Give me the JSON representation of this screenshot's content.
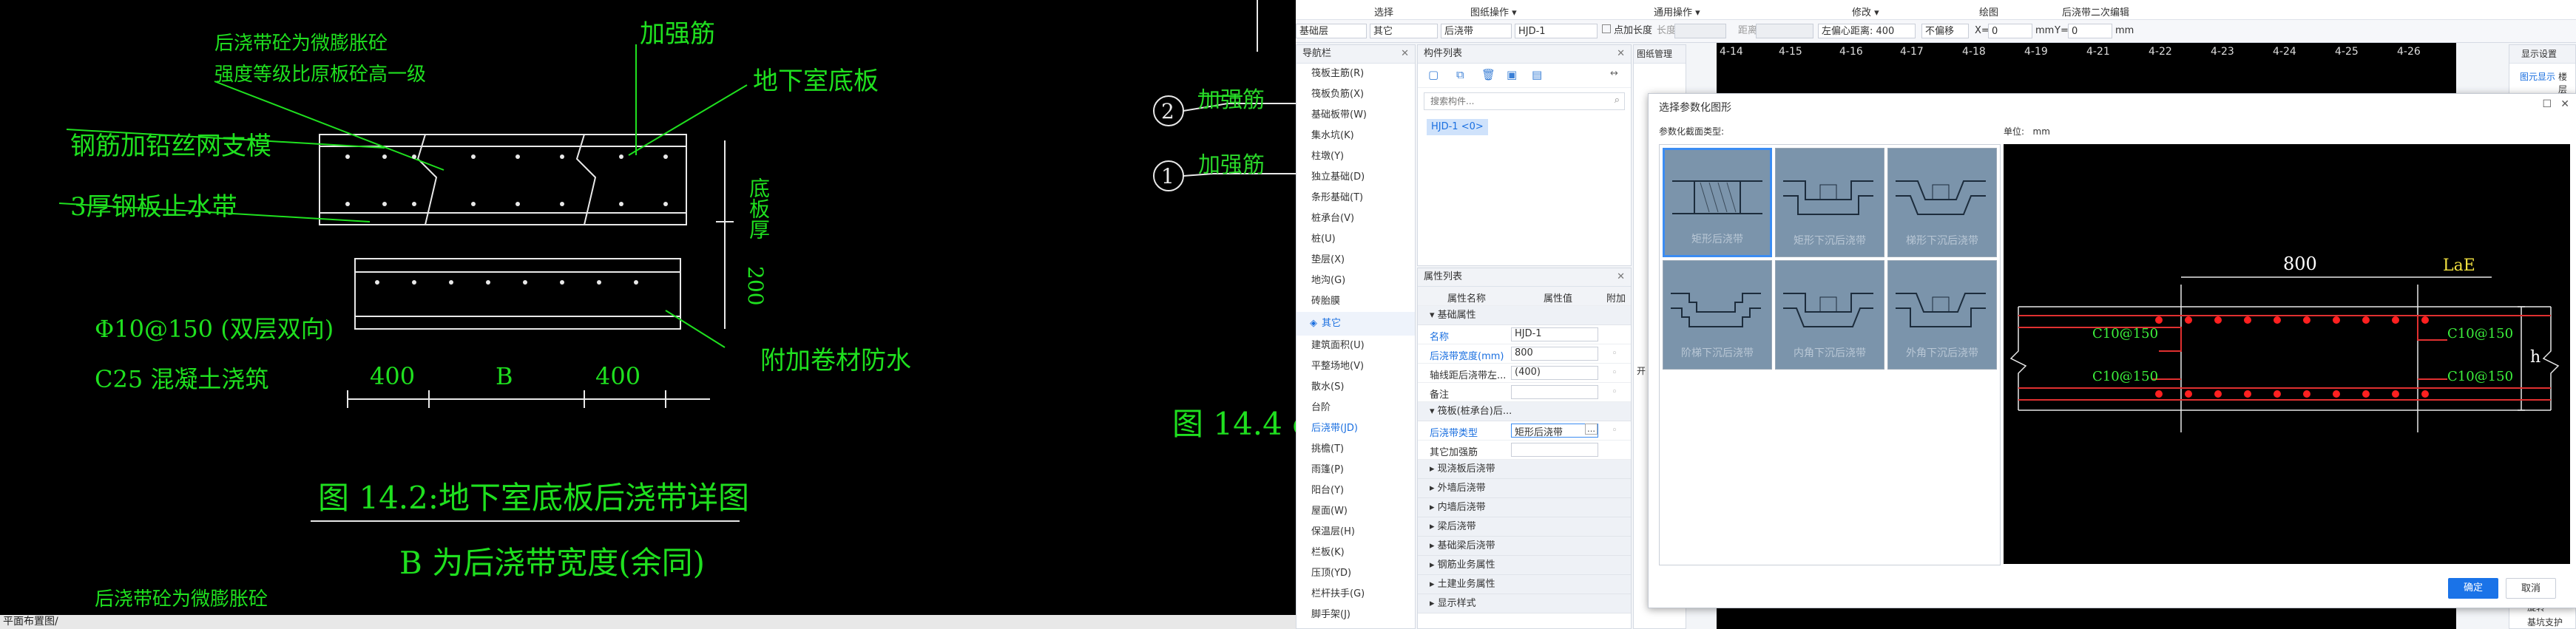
{
  "cad": {
    "notes": [
      "后浇带砼为微膨胀砼",
      "强度等级比原板砼高一级",
      "加强筋",
      "地下室底板",
      "钢筋加铅丝网支模",
      "3厚钢板止水带",
      "Φ10@150 (双层双向)",
      "C25 混凝土浇筑",
      "附加卷材防水",
      "底板厚",
      "200",
      "400",
      "B",
      "400",
      "图 14.2:地下室底板后浇带详图",
      "B 为后浇带宽度(余同)",
      "后浇带砼为微膨胀砼",
      "加强筋",
      "加强筋",
      "2",
      "1",
      "图 14.4 o"
    ],
    "status_text": "平面布置图/"
  },
  "menu": {
    "items": [
      "选择",
      "图纸操作 ▾",
      "通用操作 ▾",
      "修改 ▾",
      "绘图",
      "后浇带二次编辑"
    ]
  },
  "toolbar": {
    "layer": "基础层",
    "type": "其它",
    "category": "后浇带",
    "component": "HJD-1",
    "snap_label": "点加长度",
    "length_label": "长度:",
    "offset_label": "距离:",
    "offset_value": "左偏心距离: 400",
    "mode": "不偏移",
    "x_label": "X=",
    "x_value": "0",
    "unit1": "mm",
    "y_label": "Y=",
    "y_value": "0",
    "unit2": "mm"
  },
  "nav": {
    "title": "导航栏",
    "items": [
      "筏板主筋(R)",
      "筏板负筋(X)",
      "基础板带(W)",
      "集水坑(K)",
      "柱墩(Y)",
      "独立基础(D)",
      "条形基础(T)",
      "桩承台(V)",
      "桩(U)",
      "垫层(X)",
      "地沟(G)",
      "砖胎膜"
    ],
    "group": "其它",
    "items2": [
      "建筑面积(U)",
      "平整场地(V)",
      "散水(S)",
      "台阶",
      "后浇带(JD)",
      "挑檐(T)",
      "雨篷(P)",
      "阳台(Y)",
      "屋面(W)",
      "保温层(H)",
      "栏板(K)",
      "压顶(YD)",
      "栏杆扶手(G)",
      "脚手架(J)"
    ]
  },
  "components": {
    "title": "构件列表",
    "search_placeholder": "搜索构件...",
    "selected": "HJD-1 <0>"
  },
  "props": {
    "title": "属性列表",
    "col_name": "属性名称",
    "col_value": "属性值",
    "col_extra": "附加",
    "section_basic": "基础属性",
    "rows": [
      {
        "name": "名称",
        "value": "HJD-1"
      },
      {
        "name": "后浇带宽度(mm)",
        "value": "800"
      },
      {
        "name": "轴线距后浇带左...",
        "value": "(400)"
      },
      {
        "name": "备注",
        "value": ""
      }
    ],
    "section_2": "筏板(桩承台)后...",
    "rows2": [
      {
        "name": "后浇带类型",
        "value": "矩形后浇带"
      },
      {
        "name": "其它加强筋",
        "value": ""
      }
    ],
    "sections": [
      "现浇板后浇带",
      "外墙后浇带",
      "内墙后浇带",
      "梁后浇带",
      "基础梁后浇带",
      "钢筋业务属性",
      "土建业务属性",
      "显示样式"
    ]
  },
  "drawing_mgmt": {
    "title": "图纸管理",
    "extra": "开"
  },
  "ruler": {
    "labels": [
      "4-14",
      "4-15",
      "4-16",
      "4-17",
      "4-18",
      "4-19",
      "4-21",
      "4-22",
      "4-23",
      "4-24",
      "4-25",
      "4-26"
    ]
  },
  "right_side": {
    "title": "显示设置",
    "tab1": "图元显示",
    "tab2": "楼层",
    "bottom1": "旋转",
    "bottom2": "基坑支护"
  },
  "dialog": {
    "title": "选择参数化图形",
    "section_label": "参数化截面类型:",
    "unit_label": "单位:",
    "unit_value": "mm",
    "thumbs": [
      "矩形后浇带",
      "矩形下沉后浇带",
      "梯形下沉后浇带",
      "阶梯下沉后浇带",
      "内角下沉后浇带",
      "外角下沉后浇带"
    ],
    "preview": {
      "width_label": "800",
      "lae_label": "LaE",
      "rebar_tl": "C10@150",
      "rebar_tr": "C10@150",
      "rebar_bl": "C10@150",
      "rebar_br": "C10@150",
      "h_label": "h"
    },
    "ok": "确定",
    "cancel": "取消"
  }
}
